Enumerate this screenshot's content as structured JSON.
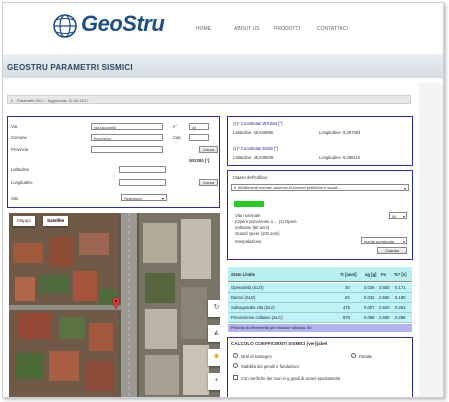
{
  "header": {
    "logo_text": "GeoStru",
    "nav": [
      "HOME",
      "ABOUT US",
      "PRODOTTI",
      "CONTATTACI"
    ]
  },
  "page_title": "GEOSTRU PARAMETRI SISMICI",
  "breadcrumb": "Parametri 2017 - Aggiornato 12-06-2017",
  "form": {
    "via_label": "Via",
    "via_value": "via taccarelli",
    "n_label": "n°",
    "n_value": "44",
    "comune_label": "Comune",
    "comune_value": "Brugherio",
    "cap_label": "Cap",
    "provincia_label": "Provincia",
    "cerca_label": "Cerca",
    "wgs84_label": "WGS84 [°]",
    "latitudine_label": "Latitudine",
    "longitudine_label": "Longitudine",
    "cerca2_label": "Cerca",
    "sito_label": "Sito",
    "sito_select": "Seleziona"
  },
  "map": {
    "tab_map": "Mappa",
    "tab_satellite": "Satellite"
  },
  "coords": {
    "wgs84_title": "(1)* Coordinate WGS84 [°]",
    "wgs84_lat": "Latitudine: 45,548880",
    "wgs84_lon": "Longitudine: 9,287064",
    "ed50_title": "(1)* Coordinate ED50 [°]",
    "ed50_lat": "Latitudine: 45,549839",
    "ed50_lon": "Longitudine: 9,288112"
  },
  "edificio": {
    "classe_label": "Classe dell'edificio",
    "classe_select": "II. Affollamenti normali, assenza di funzioni pubbliche e sociali...",
    "vita_label": "Vita nominale",
    "vita_value": "50",
    "opere_label": "(Opere provvisorie o ... (1) Opere",
    "ordinarie_label": "ordinarie (50 anni)",
    "grandi_label": "Grandi opere (100 anni)",
    "interpolazione_label": "Interpolazione",
    "interp_select": "media ponderata",
    "calcola_label": "Calcola"
  },
  "table": {
    "headers": [
      "Stato Limite",
      "Tr [anni]",
      "ag [g]",
      "Fo",
      "Tc* [s]"
    ],
    "rows": [
      [
        "Operatività (SLO)",
        "30",
        "0.026",
        "2.550",
        "0.171"
      ],
      [
        "Danno (SLD)",
        "50",
        "0.032",
        "2.580",
        "0.190"
      ],
      [
        "Salvaguardia vita (SLV)",
        "475",
        "0.057",
        "2.620",
        "0.283"
      ],
      [
        "Prevenzione collasso (SLC)",
        "975",
        "0.069",
        "2.690",
        "0.296"
      ]
    ],
    "footer": "Periodo di riferimento per l'azione sismica:   50"
  },
  "calc": {
    "title": "CALCOLO COEFFICIENTI SISMICI (ver)(abel",
    "opt1": "Muri di sostegno",
    "opt2": "Paratie",
    "opt3": "Stabilità dei pendii e fondazioni",
    "opt4": "Con verifiche dei muri in g gradi di azioni spostamenti"
  }
}
